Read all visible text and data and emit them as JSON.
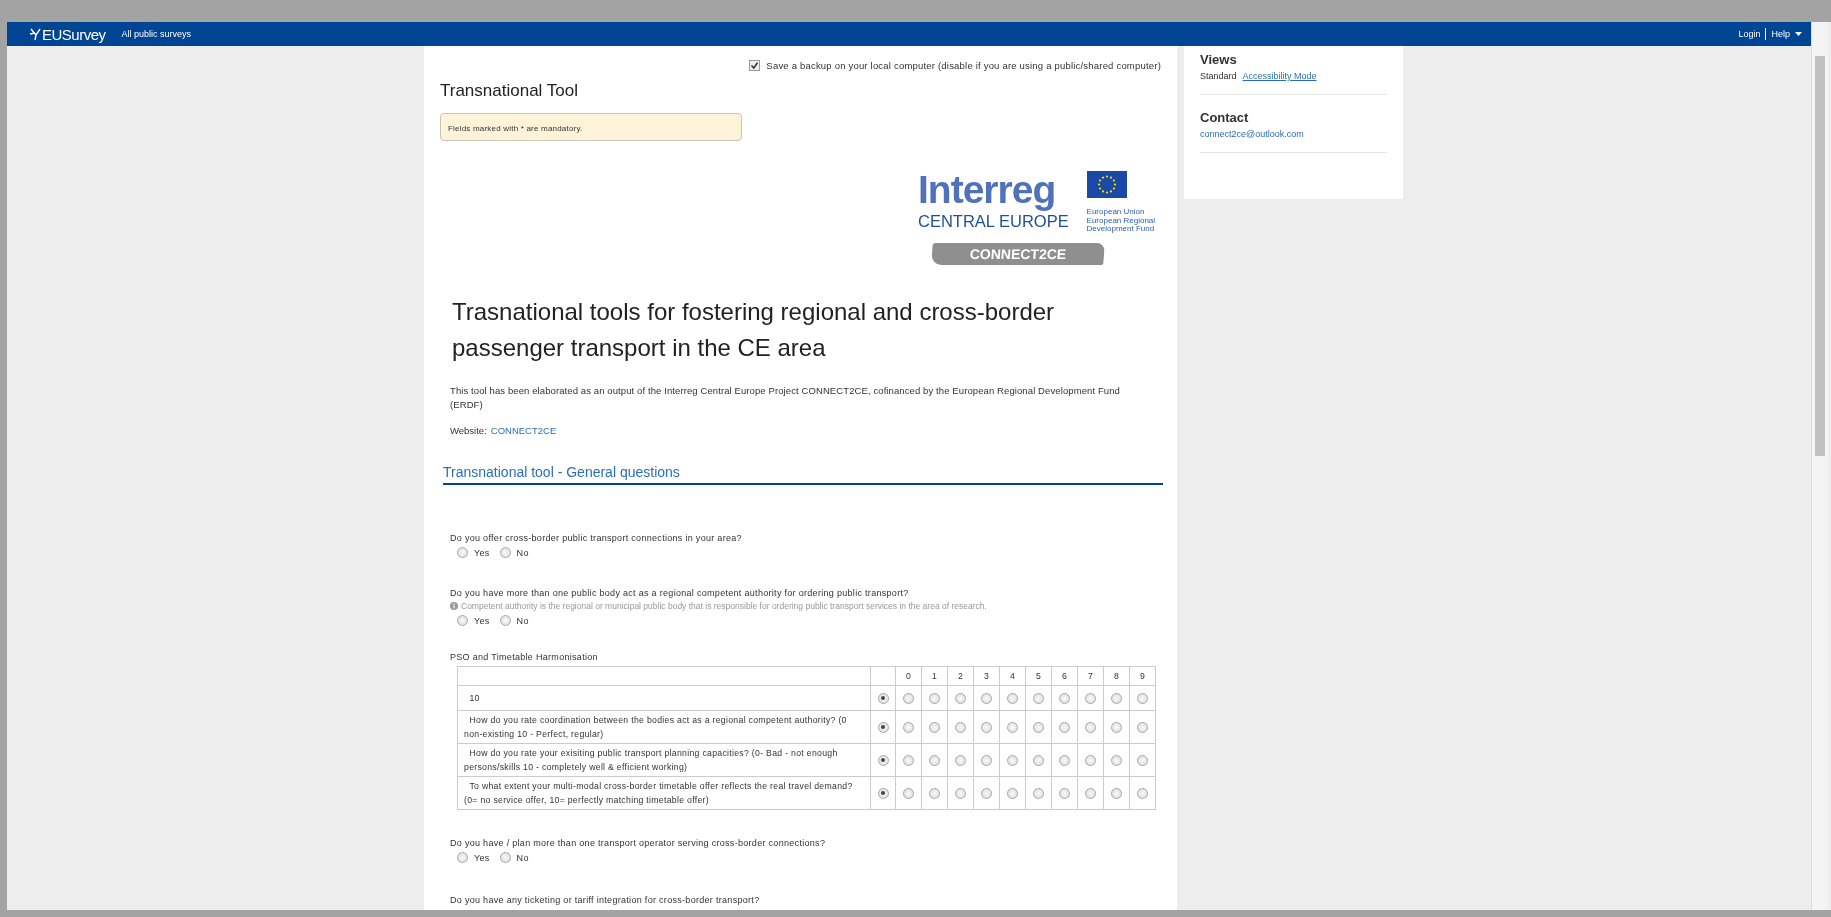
{
  "topbar": {
    "brand": "EUSurvey",
    "link": "All public surveys",
    "login": "Login",
    "help": "Help"
  },
  "backup": {
    "label": "Save a backup on your local computer (disable if you are using a public/shared computer)",
    "checked": true
  },
  "survey_title": "Transnational Tool",
  "notice": "Fields marked with * are mandatory.",
  "logo": {
    "name": "Interreg",
    "region": "CENTRAL EUROPE",
    "fund_lines": [
      "European Union",
      "European Regional",
      "Development Fund"
    ],
    "project": "CONNECT2CE"
  },
  "heading": "Trasnational tools for fostering regional and cross-border passenger transport in the CE area",
  "intro": "This tool has been elaborated as an output of the Interreg Central Europe Project CONNECT2CE, cofinanced by the European Regional Development Fund (ERDF)",
  "website": {
    "label": "Website:",
    "link": "CONNECT2CE"
  },
  "section": "Transnational tool - General questions",
  "questions": [
    {
      "kind": "radio",
      "text": "Do you offer cross-border public transport connections in your area?",
      "options": [
        {
          "label": "Yes",
          "selected": false
        },
        {
          "label": "No",
          "selected": false
        }
      ]
    },
    {
      "kind": "radio",
      "text": "Do you have more than one public body act as a regional competent authority for ordering public transport?",
      "help": "Competent authority is the regional or municipal public body that is responsible for ordering public transport services in the area of research.",
      "options": [
        {
          "label": "Yes",
          "selected": false
        },
        {
          "label": "No",
          "selected": false
        }
      ]
    },
    {
      "kind": "matrix",
      "text": "PSO and Timetable Harmonisation",
      "columns": [
        "0",
        "1",
        "2",
        "3",
        "4",
        "5",
        "6",
        "7",
        "8",
        "9"
      ],
      "rows": [
        {
          "label": "10",
          "choices": [
            {
              "selected": true
            },
            {
              "selected": false
            },
            {
              "selected": false
            },
            {
              "selected": false
            },
            {
              "selected": false
            },
            {
              "selected": false
            },
            {
              "selected": false
            },
            {
              "selected": false
            },
            {
              "selected": false
            },
            {
              "selected": false
            },
            {
              "selected": false
            }
          ]
        },
        {
          "label": "How do you rate coordination between the bodies act as a regional competent authority? (0 non-existing 10 - Perfect, regular)",
          "choices": [
            {
              "selected": true
            },
            {
              "selected": false
            },
            {
              "selected": false
            },
            {
              "selected": false
            },
            {
              "selected": false
            },
            {
              "selected": false
            },
            {
              "selected": false
            },
            {
              "selected": false
            },
            {
              "selected": false
            },
            {
              "selected": false
            },
            {
              "selected": false
            }
          ]
        },
        {
          "label": "How do you rate your exisiting public transport planning capacities? (0- Bad - not enough persons/skills 10 - completely well & efficient working)",
          "choices": [
            {
              "selected": true
            },
            {
              "selected": false
            },
            {
              "selected": false
            },
            {
              "selected": false
            },
            {
              "selected": false
            },
            {
              "selected": false
            },
            {
              "selected": false
            },
            {
              "selected": false
            },
            {
              "selected": false
            },
            {
              "selected": false
            },
            {
              "selected": false
            }
          ]
        },
        {
          "label": "To what extent your multi-modal cross-border timetable offer reflects the real travel demand? (0= no service offer, 10= perfectly matching timetable offer)",
          "choices": [
            {
              "selected": true
            },
            {
              "selected": false
            },
            {
              "selected": false
            },
            {
              "selected": false
            },
            {
              "selected": false
            },
            {
              "selected": false
            },
            {
              "selected": false
            },
            {
              "selected": false
            },
            {
              "selected": false
            },
            {
              "selected": false
            },
            {
              "selected": false
            }
          ]
        }
      ]
    },
    {
      "kind": "radio",
      "text": "Do you have / plan more than one transport operator serving cross-border connections?",
      "options": [
        {
          "label": "Yes",
          "selected": false
        },
        {
          "label": "No",
          "selected": false
        }
      ]
    },
    {
      "kind": "radio",
      "text": "Do you have any ticketing or tariff integration for cross-border transport?"
    }
  ],
  "sidebar": {
    "views": {
      "title": "Views",
      "current": "Standard",
      "link": "Accessibility Mode"
    },
    "contact": {
      "title": "Contact",
      "email": "connect2ce@outlook.com"
    }
  }
}
